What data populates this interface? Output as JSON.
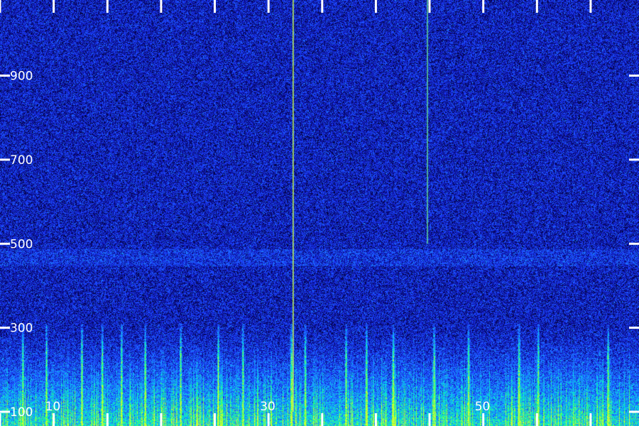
{
  "chart_data": {
    "type": "heatmap",
    "title": "",
    "xlabel": "",
    "ylabel": "",
    "xlim": [
      5,
      64.5
    ],
    "ylim": [
      100,
      1080
    ],
    "x_tick_labels": [
      "10",
      "30",
      "50"
    ],
    "y_tick_labels": [
      "100",
      "300",
      "500",
      "700",
      "900"
    ],
    "x_ticks": [
      5,
      10,
      15,
      20,
      25,
      30,
      35,
      40,
      45,
      50,
      55,
      60
    ],
    "x_tick_values_labeled": [
      10,
      30,
      50
    ],
    "y_ticks": [
      100,
      300,
      500,
      700,
      900
    ],
    "colormap": [
      "#000000",
      "#0a0a8c",
      "#1c3cff",
      "#1e90ff",
      "#00e5e5",
      "#33ff66",
      "#ccff33"
    ],
    "narrowband_lines": [
      {
        "x": 32.3,
        "y_range": [
          100,
          1080
        ],
        "color": "#c8ff50"
      },
      {
        "x": 44.8,
        "y_range": [
          500,
          1080
        ],
        "color": "#64dc96"
      }
    ],
    "broadband_transients": [
      7.1,
      9.3,
      12.6,
      14.5,
      16.3,
      18.5,
      21.8,
      25.3,
      27.6,
      32.1,
      33.4,
      37.2,
      39.1,
      41.6,
      45.4,
      48.6,
      53.3,
      55.1,
      61.6
    ],
    "grid": false,
    "legend": "none"
  }
}
